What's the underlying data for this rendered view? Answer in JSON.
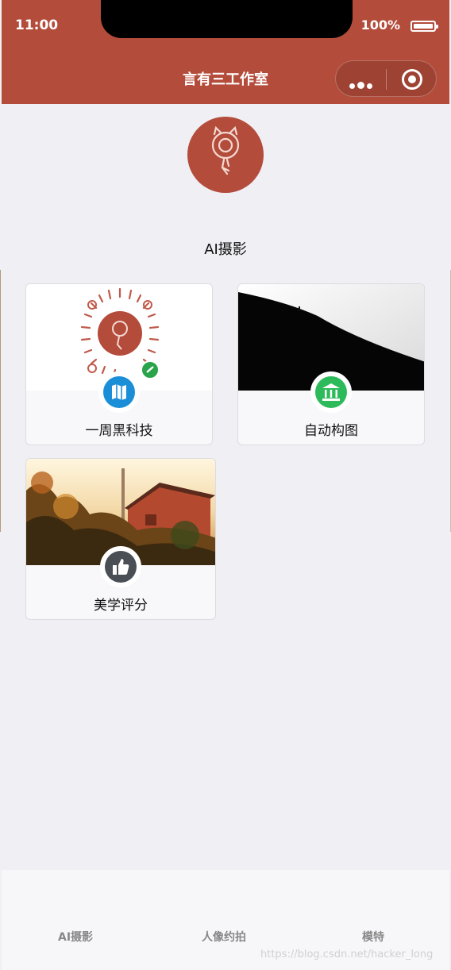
{
  "status": {
    "time": "11:00",
    "battery": "100%"
  },
  "nav": {
    "title": "言有三工作室"
  },
  "section": {
    "title": "AI摄影"
  },
  "cards": [
    {
      "label": "一周黑科技",
      "icon": "map-icon"
    },
    {
      "label": "自动构图",
      "icon": "bank-icon"
    },
    {
      "label": "美学评分",
      "icon": "thumbs-up-icon"
    }
  ],
  "tabs": [
    {
      "label": "AI摄影"
    },
    {
      "label": "人像约拍"
    },
    {
      "label": "模特"
    }
  ],
  "watermark": "https://blog.csdn.net/hacker_long",
  "colors": {
    "brand": "#b44c3b",
    "background": "#efeff4"
  }
}
